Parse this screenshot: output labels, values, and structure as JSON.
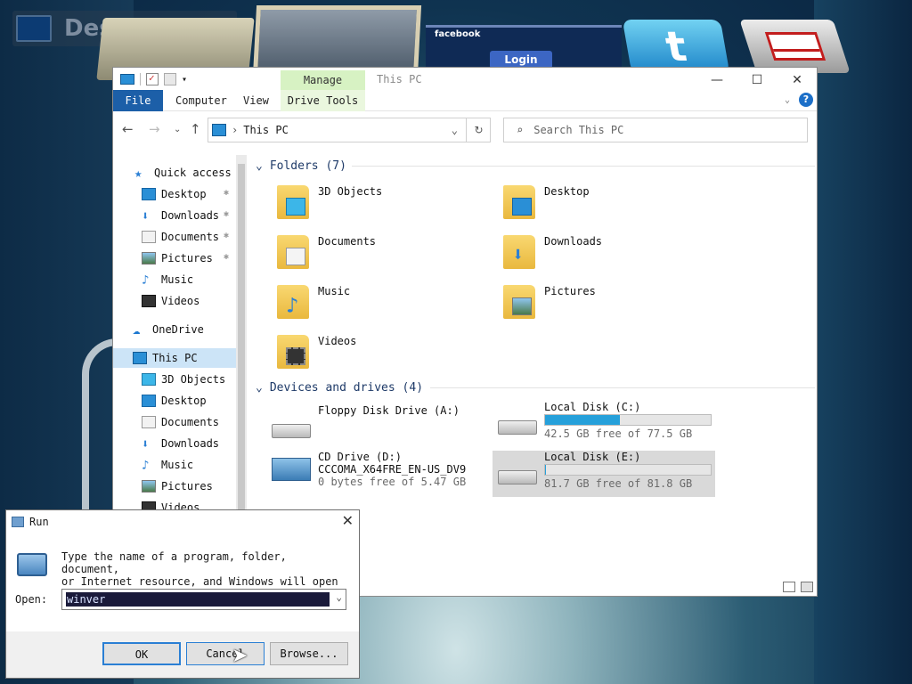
{
  "desktop": {
    "label": "Desktop",
    "facebook_title": "facebook",
    "facebook_login": "Login"
  },
  "explorer": {
    "title": "This PC",
    "contextual_tab_group": "Manage",
    "ribbon_tabs": [
      "File",
      "Computer",
      "View",
      "Drive Tools"
    ],
    "address_path": "This PC",
    "search_placeholder": "Search This PC",
    "nav": {
      "quick_access": "Quick access",
      "quick_items": [
        "Desktop",
        "Downloads",
        "Documents",
        "Pictures",
        "Music",
        "Videos"
      ],
      "onedrive": "OneDrive",
      "this_pc": "This PC",
      "pc_items": [
        "3D Objects",
        "Desktop",
        "Documents",
        "Downloads",
        "Music",
        "Pictures",
        "Videos"
      ]
    },
    "folders_header": "Folders (7)",
    "folders": [
      "3D Objects",
      "Desktop",
      "Documents",
      "Downloads",
      "Music",
      "Pictures",
      "Videos"
    ],
    "devices_header": "Devices and drives (4)",
    "drives": [
      {
        "name": "Floppy Disk Drive (A:)",
        "line2": "",
        "free": "",
        "used_fraction": null
      },
      {
        "name": "Local Disk (C:)",
        "line2": "",
        "free": "42.5 GB free of 77.5 GB",
        "used_fraction": 0.452
      },
      {
        "name": "CD Drive (D:)",
        "line2": "CCCOMA_X64FRE_EN-US_DV9",
        "free": "0 bytes free of 5.47 GB",
        "used_fraction": null
      },
      {
        "name": "Local Disk (E:)",
        "line2": "",
        "free": "81.7 GB free of 81.8 GB",
        "used_fraction": 0.001
      }
    ]
  },
  "run": {
    "title": "Run",
    "description": "Type the name of a program, folder, document,\nor Internet resource, and Windows will open\nit for you.",
    "open_label": "Open:",
    "open_value": "winver",
    "ok": "OK",
    "cancel": "Cancel",
    "browse": "Browse..."
  },
  "colors": {
    "accent": "#1c5fa8",
    "manage_tab": "#d7f2c3",
    "drive_fill": "#26a0da",
    "selection": "#cce4f7"
  }
}
